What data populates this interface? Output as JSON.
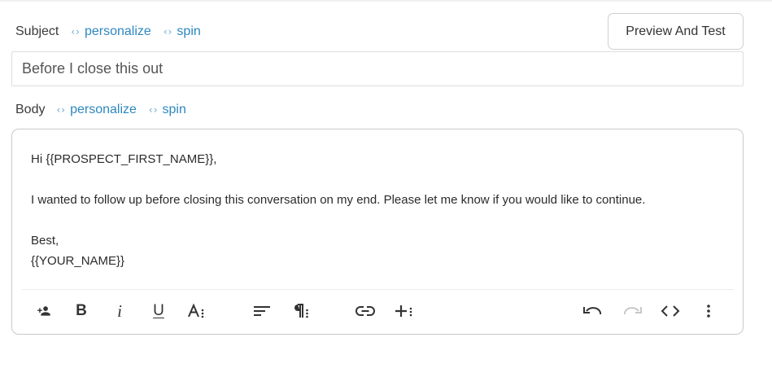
{
  "subject": {
    "label": "Subject",
    "personalize_label": "personalize",
    "spin_label": "spin",
    "value": "Before I close this out"
  },
  "preview_button": {
    "label": "Preview And Test"
  },
  "body": {
    "label": "Body",
    "personalize_label": "personalize",
    "spin_label": "spin",
    "lines": [
      "Hi {{PROSPECT_FIRST_NAME}},",
      "I wanted to follow up before closing this conversation on my end. Please let me know if you would like to continue.",
      "Best,",
      "{{YOUR_NAME}}"
    ]
  },
  "toolbar": {
    "buttons": [
      "add-person-icon",
      "bold-icon",
      "italic-icon",
      "underline-icon",
      "text-size-icon",
      "align-icon",
      "paragraph-icon",
      "link-icon",
      "insert-more-icon",
      "undo-icon",
      "redo-icon",
      "code-view-icon",
      "more-options-icon"
    ],
    "bold_glyph": "B",
    "italic_glyph": "i",
    "underline_glyph": "U"
  },
  "colors": {
    "link": "#2d87c0",
    "border": "#c9c9c9",
    "text": "#333333",
    "disabled_icon": "#c8c8c8"
  }
}
